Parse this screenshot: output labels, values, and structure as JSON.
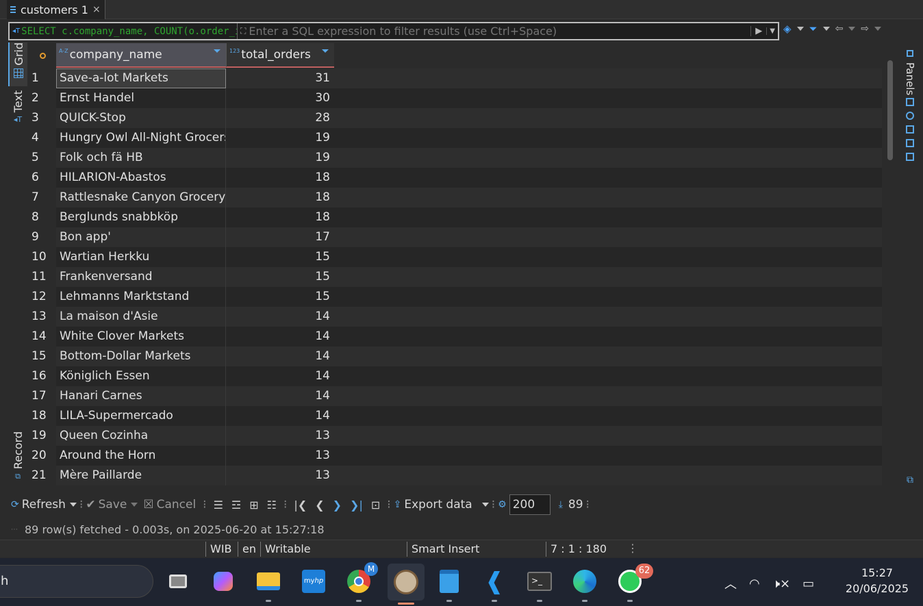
{
  "tab": {
    "title": "customers 1",
    "close": "×"
  },
  "filter": {
    "sql_preview": "SELECT c.company_name, COUNT(o.order_id)",
    "placeholder": "Enter a SQL expression to filter results (use Ctrl+Space)"
  },
  "left_tabs": {
    "grid": "Grid",
    "text": "Text",
    "record": "Record"
  },
  "right_panels": {
    "label": "Panels"
  },
  "columns": [
    {
      "name": "company_name",
      "type_icon": "A-Z"
    },
    {
      "name": "total_orders",
      "type_icon": "123"
    }
  ],
  "rows": [
    {
      "n": "1",
      "company": "Save-a-lot Markets",
      "orders": "31"
    },
    {
      "n": "2",
      "company": "Ernst Handel",
      "orders": "30"
    },
    {
      "n": "3",
      "company": "QUICK-Stop",
      "orders": "28"
    },
    {
      "n": "4",
      "company": "Hungry Owl All-Night Grocers",
      "orders": "19"
    },
    {
      "n": "5",
      "company": "Folk och fä HB",
      "orders": "19"
    },
    {
      "n": "6",
      "company": "HILARION-Abastos",
      "orders": "18"
    },
    {
      "n": "7",
      "company": "Rattlesnake Canyon Grocery",
      "orders": "18"
    },
    {
      "n": "8",
      "company": "Berglunds snabbköp",
      "orders": "18"
    },
    {
      "n": "9",
      "company": "Bon app'",
      "orders": "17"
    },
    {
      "n": "10",
      "company": "Wartian Herkku",
      "orders": "15"
    },
    {
      "n": "11",
      "company": "Frankenversand",
      "orders": "15"
    },
    {
      "n": "12",
      "company": "Lehmanns Marktstand",
      "orders": "15"
    },
    {
      "n": "13",
      "company": "La maison d'Asie",
      "orders": "14"
    },
    {
      "n": "14",
      "company": "White Clover Markets",
      "orders": "14"
    },
    {
      "n": "15",
      "company": "Bottom-Dollar Markets",
      "orders": "14"
    },
    {
      "n": "16",
      "company": "Königlich Essen",
      "orders": "14"
    },
    {
      "n": "17",
      "company": "Hanari Carnes",
      "orders": "14"
    },
    {
      "n": "18",
      "company": "LILA-Supermercado",
      "orders": "14"
    },
    {
      "n": "19",
      "company": "Queen Cozinha",
      "orders": "13"
    },
    {
      "n": "20",
      "company": "Around the Horn",
      "orders": "13"
    },
    {
      "n": "21",
      "company": "Mère Paillarde",
      "orders": "13"
    }
  ],
  "toolbar": {
    "refresh": "Refresh",
    "save": "Save",
    "cancel": "Cancel",
    "export": "Export data",
    "fetch_size": "200",
    "row_count": "89"
  },
  "status": {
    "message": "89 row(s) fetched - 0.003s, on 2025-06-20 at 15:27:18"
  },
  "editor_status": {
    "timezone": "WIB",
    "locale": "en",
    "mode": "Writable",
    "insert_mode": "Smart Insert",
    "position": "7 : 1 : 180"
  },
  "taskbar": {
    "search_text": "h",
    "chrome_badge": "M",
    "whatsapp_badge": "62",
    "time": "15:27",
    "date": "20/06/2025"
  }
}
